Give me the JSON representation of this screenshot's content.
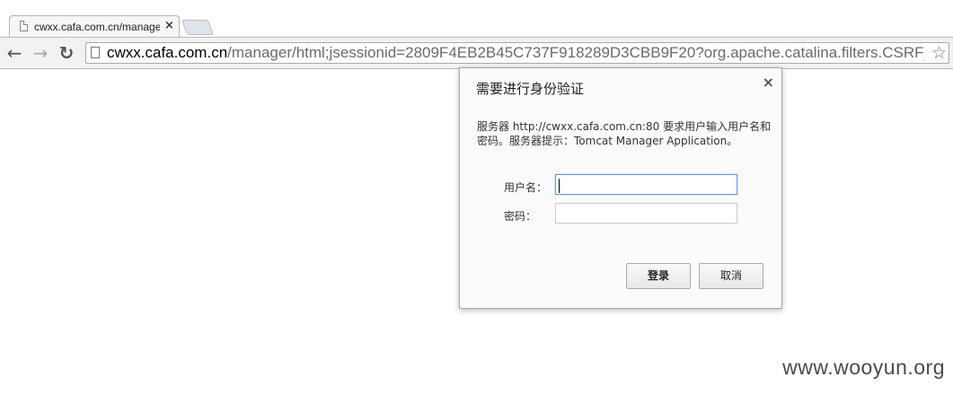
{
  "browser": {
    "tab": {
      "title": "cwxx.cafa.com.cn/manager",
      "close": "×"
    },
    "nav": {
      "back": "←",
      "forward": "→",
      "reload": "↻"
    },
    "omnibox": {
      "host": "cwxx.cafa.com.cn",
      "path": "/manager/html;jsessionid=2809F4EB2B45C737F918289D3CBB9F20?org.apache.catalina.filters.CSRF_NONCE",
      "star": "☆"
    }
  },
  "dialog": {
    "title": "需要进行身份验证",
    "close": "×",
    "message": "服务器 http://cwxx.cafa.com.cn:80 要求用户输入用户名和密码。服务器提示：Tomcat Manager Application。",
    "username_label": "用户名：",
    "password_label": "密码：",
    "username_value": "",
    "password_value": "",
    "login_button": "登录",
    "cancel_button": "取消"
  },
  "watermark": "www.wooyun.org"
}
